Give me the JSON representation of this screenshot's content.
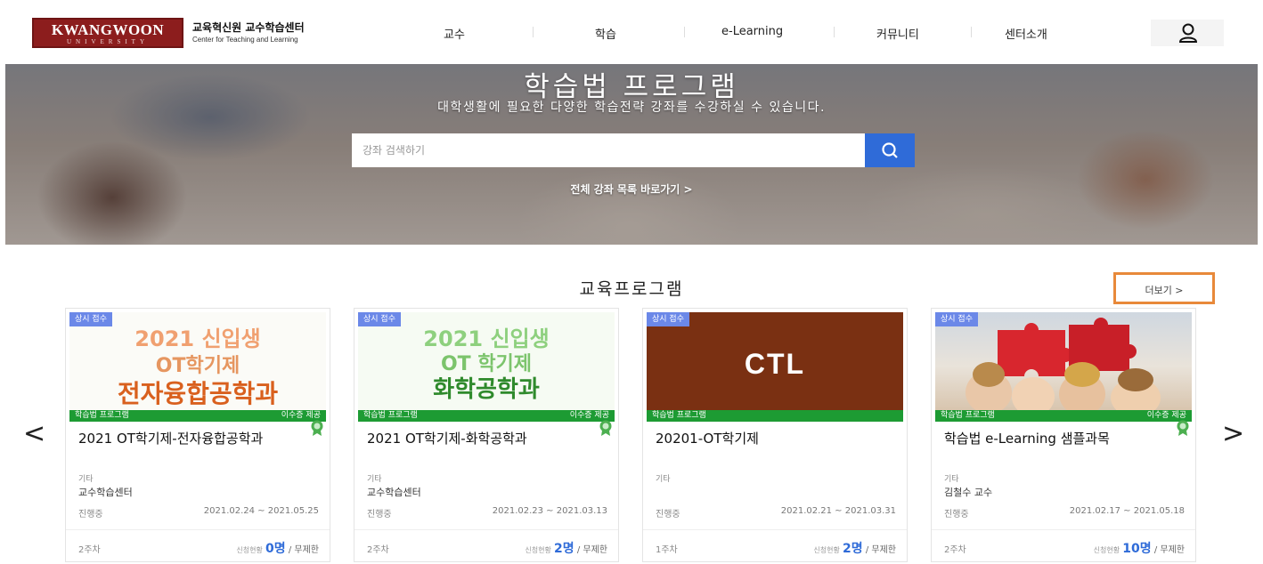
{
  "header": {
    "logo_main": "KWANGWOON",
    "logo_sub": "UNIVERSITY",
    "title": "교육혁신원 교수학습센터",
    "subtitle": "Center for Teaching and Learning",
    "nav": [
      "교수",
      "학습",
      "e-Learning",
      "커뮤니티",
      "센터소개"
    ]
  },
  "hero": {
    "title": "학습법 프로그램",
    "subtitle": "대학생활에 필요한 다양한 학습전략 강좌를 수강하실 수 있습니다.",
    "search_placeholder": "강좌 검색하기",
    "all_link": "전체 강좌 목록 바로가기 >"
  },
  "section": {
    "title": "교육프로그램",
    "more": "더보기 >"
  },
  "carousel": {
    "prev": "<",
    "next": ">"
  },
  "cards": [
    {
      "badge": "상시 접수",
      "thumb_line1": "2021 신입생",
      "thumb_line2": "OT학기제",
      "thumb_line3": "전자융합공학과",
      "bar_left": "학습법 프로그램",
      "bar_right": "이수증 제공",
      "title": "2021 OT학기제-전자융합공학과",
      "category": "기타",
      "org": "교수학습센터",
      "status": "진행중",
      "dates": "2021.02.24 ~ 2021.05.25",
      "weeks": "2주차",
      "apply_label": "신청현황",
      "apply_count": "0명",
      "apply_limit": "/ 무제한"
    },
    {
      "badge": "상시 접수",
      "thumb_line1": "2021 신입생",
      "thumb_line2": "OT 학기제",
      "thumb_line3": "화학공학과",
      "bar_left": "학습법 프로그램",
      "bar_right": "이수증 제공",
      "title": "2021 OT학기제-화학공학과",
      "category": "기타",
      "org": "교수학습센터",
      "status": "진행중",
      "dates": "2021.02.23 ~ 2021.03.13",
      "weeks": "2주차",
      "apply_label": "신청현황",
      "apply_count": "2명",
      "apply_limit": "/ 무제한"
    },
    {
      "badge": "상시 접수",
      "thumb_line1": "CTL",
      "bar_left": "학습법 프로그램",
      "title": "20201-OT학기제",
      "category": "기타",
      "status": "진행중",
      "dates": "2021.02.21 ~ 2021.03.31",
      "weeks": "1주차",
      "apply_label": "신청현황",
      "apply_count": "2명",
      "apply_limit": "/ 무제한"
    },
    {
      "badge": "상시 접수",
      "bar_left": "학습법 프로그램",
      "bar_right": "이수증 제공",
      "title": "학습법 e-Learning 샘플과목",
      "category": "기타",
      "org": "김철수 교수",
      "status": "진행중",
      "dates": "2021.02.17 ~ 2021.05.18",
      "weeks": "2주차",
      "apply_label": "신청현황",
      "apply_count": "10명",
      "apply_limit": "/ 무제한"
    }
  ],
  "colors": {
    "brand": "#8c1d1d",
    "accent_blue": "#2f6bd8",
    "green": "#1d9b33",
    "more_border": "#e8893a"
  }
}
